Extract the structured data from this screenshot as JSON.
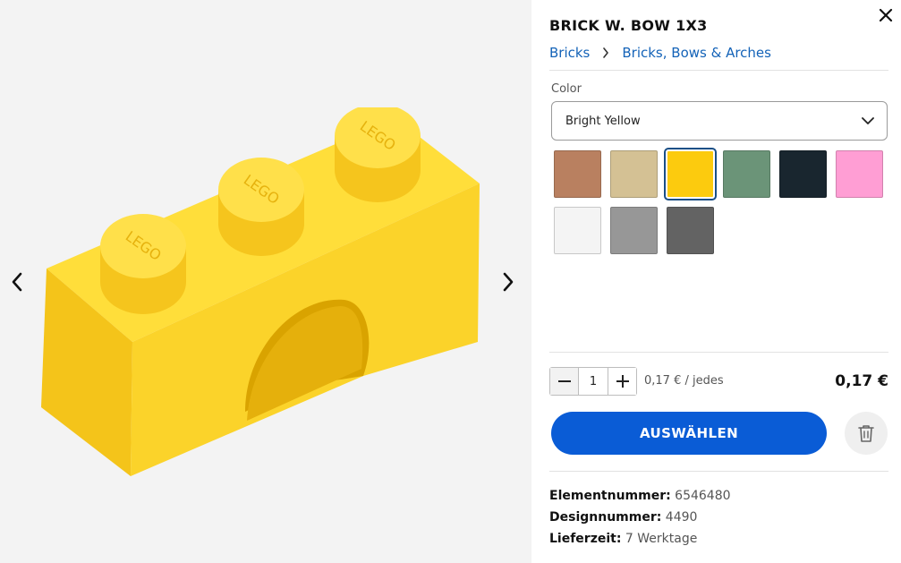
{
  "product": {
    "title": "BRICK W. BOW 1X3",
    "breadcrumb": [
      "Bricks",
      "Bricks, Bows & Arches"
    ],
    "image_alt": "Yellow 1x3 brick with bow"
  },
  "color": {
    "label": "Color",
    "selected": "Bright Yellow",
    "swatches": [
      {
        "name": "Medium Nougat",
        "hex": "#b98060"
      },
      {
        "name": "Brick Yellow",
        "hex": "#d4c194"
      },
      {
        "name": "Bright Yellow",
        "hex": "#fccb0e",
        "selected": true
      },
      {
        "name": "Sand Green",
        "hex": "#6b9478"
      },
      {
        "name": "Earth Blue",
        "hex": "#19262f"
      },
      {
        "name": "Light Purple",
        "hex": "#ff9ed4"
      },
      {
        "name": "White",
        "hex": "#f4f4f4"
      },
      {
        "name": "Medium Stone Grey",
        "hex": "#979797"
      },
      {
        "name": "Dark Stone Grey",
        "hex": "#636363"
      }
    ]
  },
  "purchase": {
    "quantity": "1",
    "unit_price": "0,17 € / jedes",
    "total_price": "0,17 €",
    "cta_label": "AUSWÄHLEN"
  },
  "specs": {
    "element_label": "Elementnummer:",
    "element_value": "6546480",
    "design_label": "Designnummer:",
    "design_value": "4490",
    "delivery_label": "Lieferzeit:",
    "delivery_value": "7 Werktage"
  },
  "icons": {
    "prev": "chevron-left-icon",
    "next": "chevron-right-icon",
    "close": "close-icon",
    "dropdown": "chevron-down-icon",
    "breadcrumb_sep": "chevron-right-icon",
    "delete": "trash-icon"
  },
  "colors": {
    "accent": "#0a5cd6",
    "link": "#1463b8",
    "gallery_bg": "#f3f3f3"
  }
}
